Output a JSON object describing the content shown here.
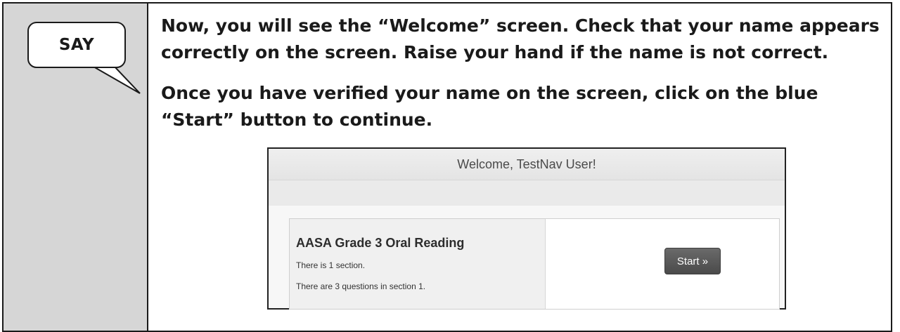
{
  "callout": {
    "label": "SAY"
  },
  "instructions": {
    "paragraph_1": "Now, you will see the “Welcome” screen. Check that your name appears correctly on the screen. Raise your hand if the name is not correct.",
    "paragraph_2": "Once you have verified your name on the screen, click on the blue “Start” button to continue."
  },
  "screenshot": {
    "header_title": "Welcome, TestNav User!",
    "test": {
      "name": "AASA Grade 3 Oral Reading",
      "sections_line": "There is 1 section.",
      "questions_line": "There are 3 questions in section 1."
    },
    "start_button_label": "Start »"
  }
}
